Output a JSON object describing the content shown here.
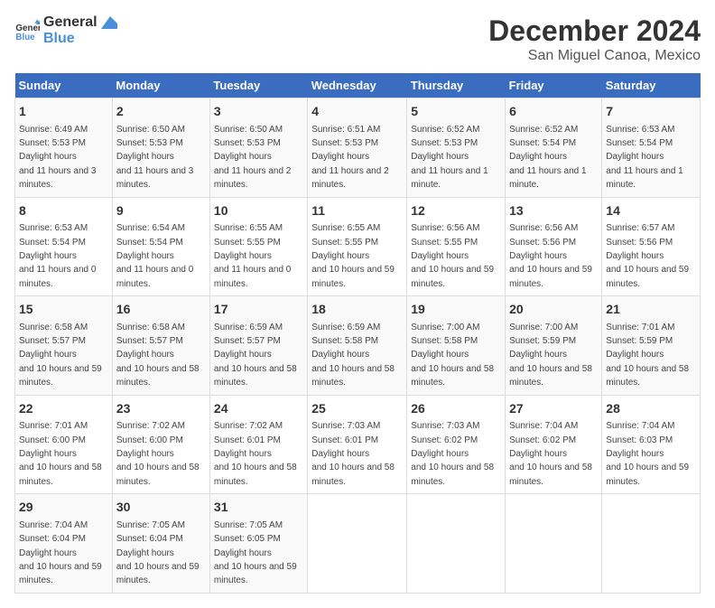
{
  "header": {
    "logo_general": "General",
    "logo_blue": "Blue",
    "title": "December 2024",
    "subtitle": "San Miguel Canoa, Mexico"
  },
  "days_of_week": [
    "Sunday",
    "Monday",
    "Tuesday",
    "Wednesday",
    "Thursday",
    "Friday",
    "Saturday"
  ],
  "weeks": [
    [
      {
        "day": "1",
        "sunrise": "6:49 AM",
        "sunset": "5:53 PM",
        "daylight": "11 hours and 3 minutes."
      },
      {
        "day": "2",
        "sunrise": "6:50 AM",
        "sunset": "5:53 PM",
        "daylight": "11 hours and 3 minutes."
      },
      {
        "day": "3",
        "sunrise": "6:50 AM",
        "sunset": "5:53 PM",
        "daylight": "11 hours and 2 minutes."
      },
      {
        "day": "4",
        "sunrise": "6:51 AM",
        "sunset": "5:53 PM",
        "daylight": "11 hours and 2 minutes."
      },
      {
        "day": "5",
        "sunrise": "6:52 AM",
        "sunset": "5:53 PM",
        "daylight": "11 hours and 1 minute."
      },
      {
        "day": "6",
        "sunrise": "6:52 AM",
        "sunset": "5:54 PM",
        "daylight": "11 hours and 1 minute."
      },
      {
        "day": "7",
        "sunrise": "6:53 AM",
        "sunset": "5:54 PM",
        "daylight": "11 hours and 1 minute."
      }
    ],
    [
      {
        "day": "8",
        "sunrise": "6:53 AM",
        "sunset": "5:54 PM",
        "daylight": "11 hours and 0 minutes."
      },
      {
        "day": "9",
        "sunrise": "6:54 AM",
        "sunset": "5:54 PM",
        "daylight": "11 hours and 0 minutes."
      },
      {
        "day": "10",
        "sunrise": "6:55 AM",
        "sunset": "5:55 PM",
        "daylight": "11 hours and 0 minutes."
      },
      {
        "day": "11",
        "sunrise": "6:55 AM",
        "sunset": "5:55 PM",
        "daylight": "10 hours and 59 minutes."
      },
      {
        "day": "12",
        "sunrise": "6:56 AM",
        "sunset": "5:55 PM",
        "daylight": "10 hours and 59 minutes."
      },
      {
        "day": "13",
        "sunrise": "6:56 AM",
        "sunset": "5:56 PM",
        "daylight": "10 hours and 59 minutes."
      },
      {
        "day": "14",
        "sunrise": "6:57 AM",
        "sunset": "5:56 PM",
        "daylight": "10 hours and 59 minutes."
      }
    ],
    [
      {
        "day": "15",
        "sunrise": "6:58 AM",
        "sunset": "5:57 PM",
        "daylight": "10 hours and 59 minutes."
      },
      {
        "day": "16",
        "sunrise": "6:58 AM",
        "sunset": "5:57 PM",
        "daylight": "10 hours and 58 minutes."
      },
      {
        "day": "17",
        "sunrise": "6:59 AM",
        "sunset": "5:57 PM",
        "daylight": "10 hours and 58 minutes."
      },
      {
        "day": "18",
        "sunrise": "6:59 AM",
        "sunset": "5:58 PM",
        "daylight": "10 hours and 58 minutes."
      },
      {
        "day": "19",
        "sunrise": "7:00 AM",
        "sunset": "5:58 PM",
        "daylight": "10 hours and 58 minutes."
      },
      {
        "day": "20",
        "sunrise": "7:00 AM",
        "sunset": "5:59 PM",
        "daylight": "10 hours and 58 minutes."
      },
      {
        "day": "21",
        "sunrise": "7:01 AM",
        "sunset": "5:59 PM",
        "daylight": "10 hours and 58 minutes."
      }
    ],
    [
      {
        "day": "22",
        "sunrise": "7:01 AM",
        "sunset": "6:00 PM",
        "daylight": "10 hours and 58 minutes."
      },
      {
        "day": "23",
        "sunrise": "7:02 AM",
        "sunset": "6:00 PM",
        "daylight": "10 hours and 58 minutes."
      },
      {
        "day": "24",
        "sunrise": "7:02 AM",
        "sunset": "6:01 PM",
        "daylight": "10 hours and 58 minutes."
      },
      {
        "day": "25",
        "sunrise": "7:03 AM",
        "sunset": "6:01 PM",
        "daylight": "10 hours and 58 minutes."
      },
      {
        "day": "26",
        "sunrise": "7:03 AM",
        "sunset": "6:02 PM",
        "daylight": "10 hours and 58 minutes."
      },
      {
        "day": "27",
        "sunrise": "7:04 AM",
        "sunset": "6:02 PM",
        "daylight": "10 hours and 58 minutes."
      },
      {
        "day": "28",
        "sunrise": "7:04 AM",
        "sunset": "6:03 PM",
        "daylight": "10 hours and 59 minutes."
      }
    ],
    [
      {
        "day": "29",
        "sunrise": "7:04 AM",
        "sunset": "6:04 PM",
        "daylight": "10 hours and 59 minutes."
      },
      {
        "day": "30",
        "sunrise": "7:05 AM",
        "sunset": "6:04 PM",
        "daylight": "10 hours and 59 minutes."
      },
      {
        "day": "31",
        "sunrise": "7:05 AM",
        "sunset": "6:05 PM",
        "daylight": "10 hours and 59 minutes."
      },
      null,
      null,
      null,
      null
    ]
  ],
  "labels": {
    "sunrise": "Sunrise:",
    "sunset": "Sunset:",
    "daylight": "Daylight hours"
  }
}
